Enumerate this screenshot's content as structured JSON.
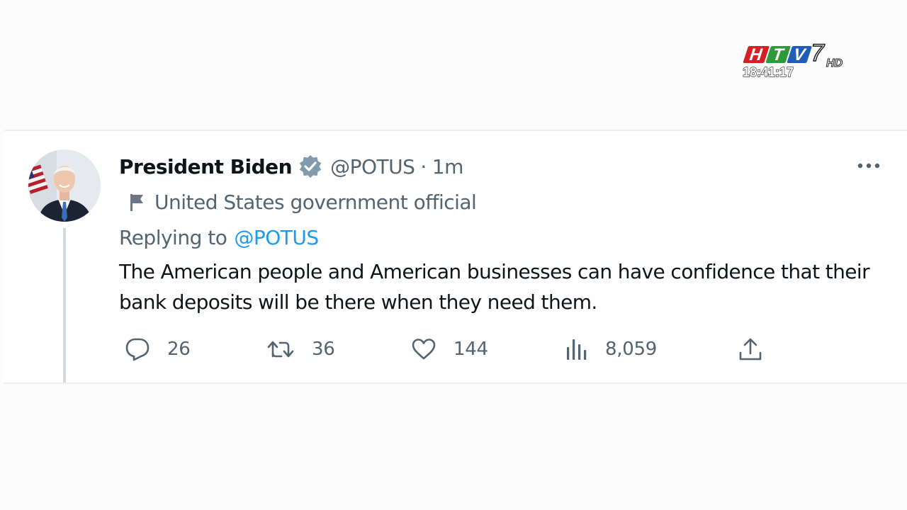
{
  "watermark": {
    "channel_logo": "HTV7 HD",
    "clock": "18:41:17"
  },
  "tweet": {
    "avatar_icon": "profile-photo",
    "display_name": "President Biden",
    "verified_icon": "verified-badge-icon",
    "handle": "@POTUS",
    "separator": "·",
    "timestamp": "1m",
    "more_icon": "more-options-icon",
    "label": {
      "icon": "flag-icon",
      "text": "United States government official"
    },
    "reply": {
      "prefix": "Replying to",
      "mention": "@POTUS"
    },
    "body": "The American people and American businesses can have confidence that their bank deposits will be there when they need them.",
    "actions": {
      "reply": {
        "icon": "reply-icon",
        "count": "26"
      },
      "retweet": {
        "icon": "retweet-icon",
        "count": "36"
      },
      "like": {
        "icon": "heart-icon",
        "count": "144"
      },
      "views": {
        "icon": "analytics-icon",
        "count": "8,059"
      },
      "share": {
        "icon": "share-icon"
      }
    },
    "colors": {
      "text": "#0f1419",
      "secondary": "#536471",
      "link": "#1d9bf0",
      "verified": "#829aab"
    }
  }
}
